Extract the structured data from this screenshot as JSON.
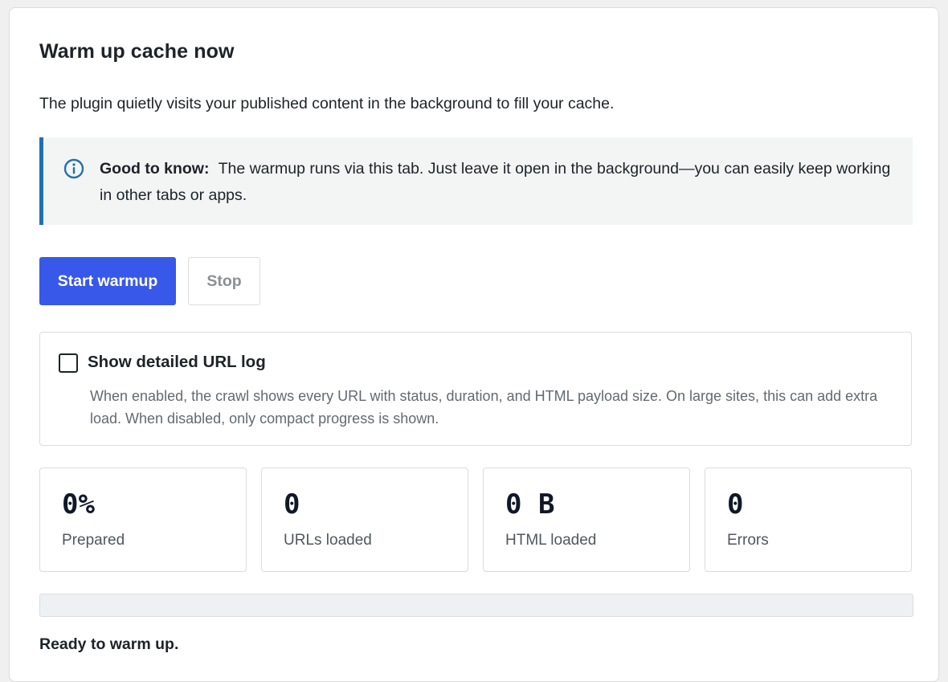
{
  "panel": {
    "title": "Warm up cache now",
    "intro": "The plugin quietly visits your published content in the background to fill your cache."
  },
  "notice": {
    "icon": "info-icon",
    "label": "Good to know:",
    "text": "The warmup runs via this tab. Just leave it open in the background—you can easily keep working in other tabs or apps.",
    "accent_color": "#2271b1"
  },
  "actions": {
    "start_label": "Start warmup",
    "stop_label": "Stop",
    "primary_color": "#3858e9"
  },
  "detailed_log": {
    "label": "Show detailed URL log",
    "checked": false,
    "description": "When enabled, the crawl shows every URL with status, duration, and HTML payload size. On large sites, this can add extra load. When disabled, only compact progress is shown."
  },
  "stats": [
    {
      "value": "0%",
      "label": "Prepared"
    },
    {
      "value": "0",
      "label": "URLs loaded"
    },
    {
      "value": "0 B",
      "label": "HTML loaded"
    },
    {
      "value": "0",
      "label": "Errors"
    }
  ],
  "progress": {
    "fraction": 0
  },
  "status": {
    "text": "Ready to warm up."
  }
}
